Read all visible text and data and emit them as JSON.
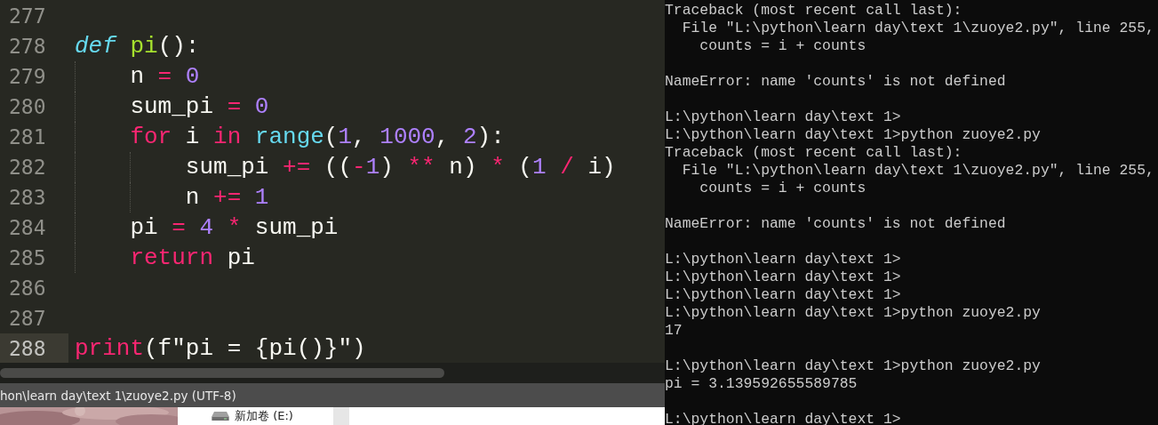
{
  "editor": {
    "lines": [
      {
        "number": "277",
        "current": false
      },
      {
        "number": "278",
        "current": false,
        "tokens": [
          {
            "text": "def ",
            "kind": "storage"
          },
          {
            "text": "pi",
            "kind": "function"
          },
          {
            "text": "():",
            "kind": "plain"
          }
        ]
      },
      {
        "number": "279",
        "current": false,
        "tokens": [
          {
            "text": "    n",
            "kind": "plain"
          },
          {
            "text": " = ",
            "kind": "keyword"
          },
          {
            "text": "0",
            "kind": "number"
          }
        ]
      },
      {
        "number": "280",
        "current": false,
        "tokens": [
          {
            "text": "    sum_pi",
            "kind": "plain"
          },
          {
            "text": " = ",
            "kind": "keyword"
          },
          {
            "text": "0",
            "kind": "number"
          }
        ]
      },
      {
        "number": "281",
        "current": false,
        "tokens": [
          {
            "text": "    for",
            "kind": "keyword"
          },
          {
            "text": " i ",
            "kind": "plain"
          },
          {
            "text": "in ",
            "kind": "keyword"
          },
          {
            "text": "range",
            "kind": "builtin"
          },
          {
            "text": "(",
            "kind": "plain"
          },
          {
            "text": "1",
            "kind": "number"
          },
          {
            "text": ", ",
            "kind": "plain"
          },
          {
            "text": "1000",
            "kind": "number"
          },
          {
            "text": ", ",
            "kind": "plain"
          },
          {
            "text": "2",
            "kind": "number"
          },
          {
            "text": "):",
            "kind": "plain"
          }
        ]
      },
      {
        "number": "282",
        "current": false,
        "tokens": [
          {
            "text": "        sum_pi",
            "kind": "plain"
          },
          {
            "text": " += ",
            "kind": "keyword"
          },
          {
            "text": "((",
            "kind": "plain"
          },
          {
            "text": "-",
            "kind": "keyword"
          },
          {
            "text": "1",
            "kind": "number"
          },
          {
            "text": ")",
            "kind": "plain"
          },
          {
            "text": " ** ",
            "kind": "keyword"
          },
          {
            "text": "n)",
            "kind": "plain"
          },
          {
            "text": " * ",
            "kind": "keyword"
          },
          {
            "text": "(",
            "kind": "plain"
          },
          {
            "text": "1",
            "kind": "number"
          },
          {
            "text": " / ",
            "kind": "keyword"
          },
          {
            "text": "i)",
            "kind": "plain"
          }
        ]
      },
      {
        "number": "283",
        "current": false,
        "tokens": [
          {
            "text": "        n",
            "kind": "plain"
          },
          {
            "text": " += ",
            "kind": "keyword"
          },
          {
            "text": "1",
            "kind": "number"
          }
        ]
      },
      {
        "number": "284",
        "current": false,
        "tokens": [
          {
            "text": "    pi",
            "kind": "plain"
          },
          {
            "text": " = ",
            "kind": "keyword"
          },
          {
            "text": "4",
            "kind": "number"
          },
          {
            "text": " * ",
            "kind": "keyword"
          },
          {
            "text": "sum_pi",
            "kind": "plain"
          }
        ]
      },
      {
        "number": "285",
        "current": false,
        "tokens": [
          {
            "text": "    return",
            "kind": "keyword"
          },
          {
            "text": " pi",
            "kind": "plain"
          }
        ]
      },
      {
        "number": "286",
        "current": false
      },
      {
        "number": "287",
        "current": false
      },
      {
        "number": "288",
        "current": true,
        "tokens": [
          {
            "text": "print",
            "kind": "keyword"
          },
          {
            "text": "(f\"pi = {pi()}\")",
            "kind": "plain"
          }
        ]
      }
    ],
    "status_bar": "hon\\learn day\\text 1\\zuoye2.py (UTF-8)"
  },
  "explorer": {
    "drive_label": "新加卷 (E:)"
  },
  "terminal": {
    "blocks": [
      [
        "Traceback (most recent call last):",
        "  File \"L:\\python\\learn day\\text 1\\zuoye2.py\", line 255,",
        "    counts = i + counts"
      ],
      [
        "NameError: name 'counts' is not defined"
      ],
      [
        "L:\\python\\learn day\\text 1>",
        "L:\\python\\learn day\\text 1>python zuoye2.py",
        "Traceback (most recent call last):",
        "  File \"L:\\python\\learn day\\text 1\\zuoye2.py\", line 255,",
        "    counts = i + counts"
      ],
      [
        "NameError: name 'counts' is not defined"
      ],
      [
        "L:\\python\\learn day\\text 1>",
        "L:\\python\\learn day\\text 1>",
        "L:\\python\\learn day\\text 1>",
        "L:\\python\\learn day\\text 1>python zuoye2.py",
        "17"
      ],
      [
        "L:\\python\\learn day\\text 1>python zuoye2.py",
        "pi = 3.139592655589785"
      ],
      [
        "L:\\python\\learn day\\text 1>"
      ]
    ]
  }
}
